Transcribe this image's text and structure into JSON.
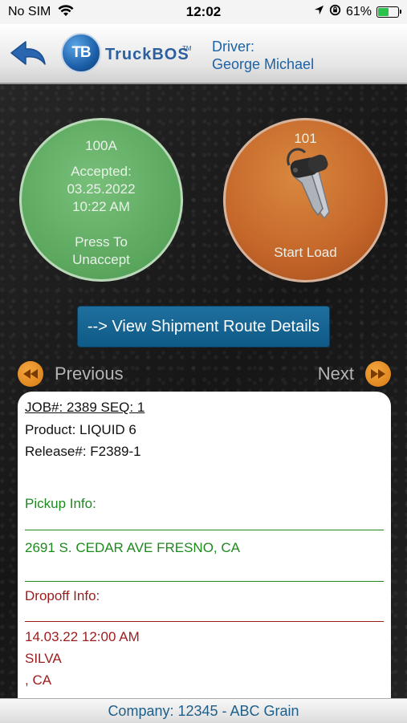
{
  "status_bar": {
    "carrier": "No SIM",
    "time": "12:02",
    "battery": "61%",
    "battery_level": 0.61
  },
  "header": {
    "logo_initials": "TB",
    "logo_name": "TruckBOS",
    "logo_tm": "TM",
    "driver_label": "Driver:",
    "driver_name": "George Michael"
  },
  "load_status": {
    "id": "100A",
    "state": "Accepted:",
    "date": "03.25.2022",
    "time": "10:22 AM",
    "action_line1": "Press To",
    "action_line2": "Unaccept",
    "color": "#5aa65d"
  },
  "start_load": {
    "id": "101",
    "label": "Start Load",
    "icon": "keys-icon",
    "color": "#c4662a"
  },
  "route_button": {
    "label": "--> View Shipment Route Details"
  },
  "nav": {
    "previous": "Previous",
    "next": "Next"
  },
  "shipment": {
    "job": "JOB#: 2389 SEQ: 1",
    "product": "Product: LIQUID 6",
    "release": "Release#: F2389-1",
    "pickup_label": "Pickup Info:",
    "pickup_address": "2691 S. CEDAR AVE FRESNO, CA",
    "dropoff_label": "Dropoff Info:",
    "dropoff_datetime": "14.03.22 12:00 AM",
    "dropoff_name": "SILVA",
    "dropoff_location": ", CA"
  },
  "footer": {
    "company": "Company: 12345 - ABC Grain"
  }
}
